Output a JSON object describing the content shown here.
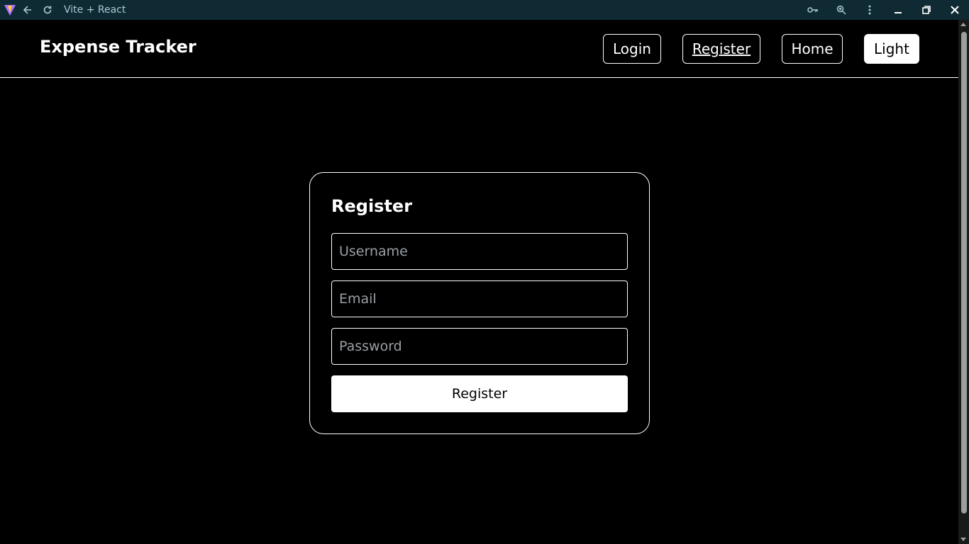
{
  "browser": {
    "tab_title": "Vite + React",
    "icons": [
      "vite-logo-icon",
      "back-icon",
      "reload-icon",
      "key-icon",
      "zoom-icon",
      "menu-icon",
      "minimize-icon",
      "maximize-icon",
      "close-icon"
    ]
  },
  "navbar": {
    "brand": "Expense Tracker",
    "links": {
      "login": "Login",
      "register": "Register",
      "home": "Home",
      "theme": "Light"
    }
  },
  "register_form": {
    "title": "Register",
    "username_placeholder": "Username",
    "email_placeholder": "Email",
    "password_placeholder": "Password",
    "submit_label": "Register"
  },
  "colors": {
    "background": "#000000",
    "foreground": "#ffffff",
    "chrome": "#0f2a33"
  }
}
